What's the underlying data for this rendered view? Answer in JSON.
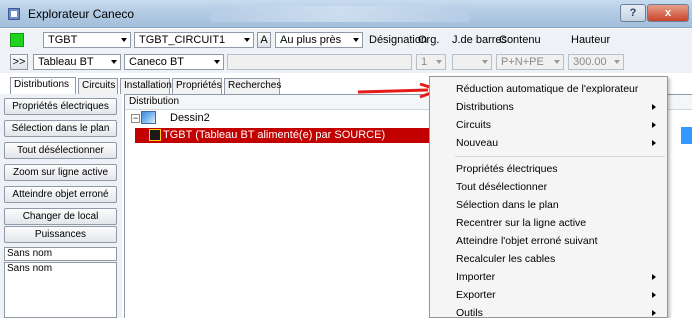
{
  "window": {
    "title": "Explorateur Caneco",
    "help_label": "?",
    "close_label": "x"
  },
  "toolbar1": {
    "combo1": "TGBT",
    "combo2": "TGBT_CIRCUIT1",
    "btn_a": "A",
    "combo3": "Au plus près",
    "labels": [
      "Désignation",
      "Org.",
      "J.de barres",
      "Contenu",
      "Hauteur"
    ]
  },
  "toolbar2": {
    "expand_btn": ">>",
    "combo1": "Tableau BT",
    "combo2": "Caneco BT",
    "org_value": "1",
    "contenu_value": "P+N+PE",
    "hauteur_value": "300.00"
  },
  "tabs": [
    "Distributions",
    "Circuits",
    "Installation",
    "Propriétés",
    "Recherches"
  ],
  "left_buttons": [
    "Propriétés électriques",
    "Sélection dans le plan",
    "Tout désélectionner",
    "Zoom sur ligne active",
    "Atteindre objet erroné",
    "Changer de local",
    "Puissances"
  ],
  "name_input": "Sans nom",
  "name_list": [
    "Sans nom"
  ],
  "tree": {
    "header": "Distribution",
    "root_label": "Dessin2",
    "selected_label": "TGBT (Tableau BT alimenté(e) par SOURCE)"
  },
  "menu": {
    "items": [
      {
        "label": "Réduction automatique de l'explorateur",
        "sub": false
      },
      {
        "label": "Distributions",
        "sub": true
      },
      {
        "label": "Circuits",
        "sub": true
      },
      {
        "label": "Nouveau",
        "sub": true
      },
      {
        "label": "Propriétés électriques",
        "sub": false
      },
      {
        "label": "Tout désélectionner",
        "sub": false
      },
      {
        "label": "Sélection dans le plan",
        "sub": false
      },
      {
        "label": "Recentrer sur la ligne active",
        "sub": false
      },
      {
        "label": "Atteindre l'objet erroné suivant",
        "sub": false
      },
      {
        "label": "Recalculer les cables",
        "sub": false
      },
      {
        "label": "Importer",
        "sub": true
      },
      {
        "label": "Exporter",
        "sub": true
      },
      {
        "label": "Outils",
        "sub": true
      }
    ]
  },
  "colors": {
    "selection": "#c20000",
    "arrow": "#e41b17",
    "status_green": "#21d321"
  }
}
